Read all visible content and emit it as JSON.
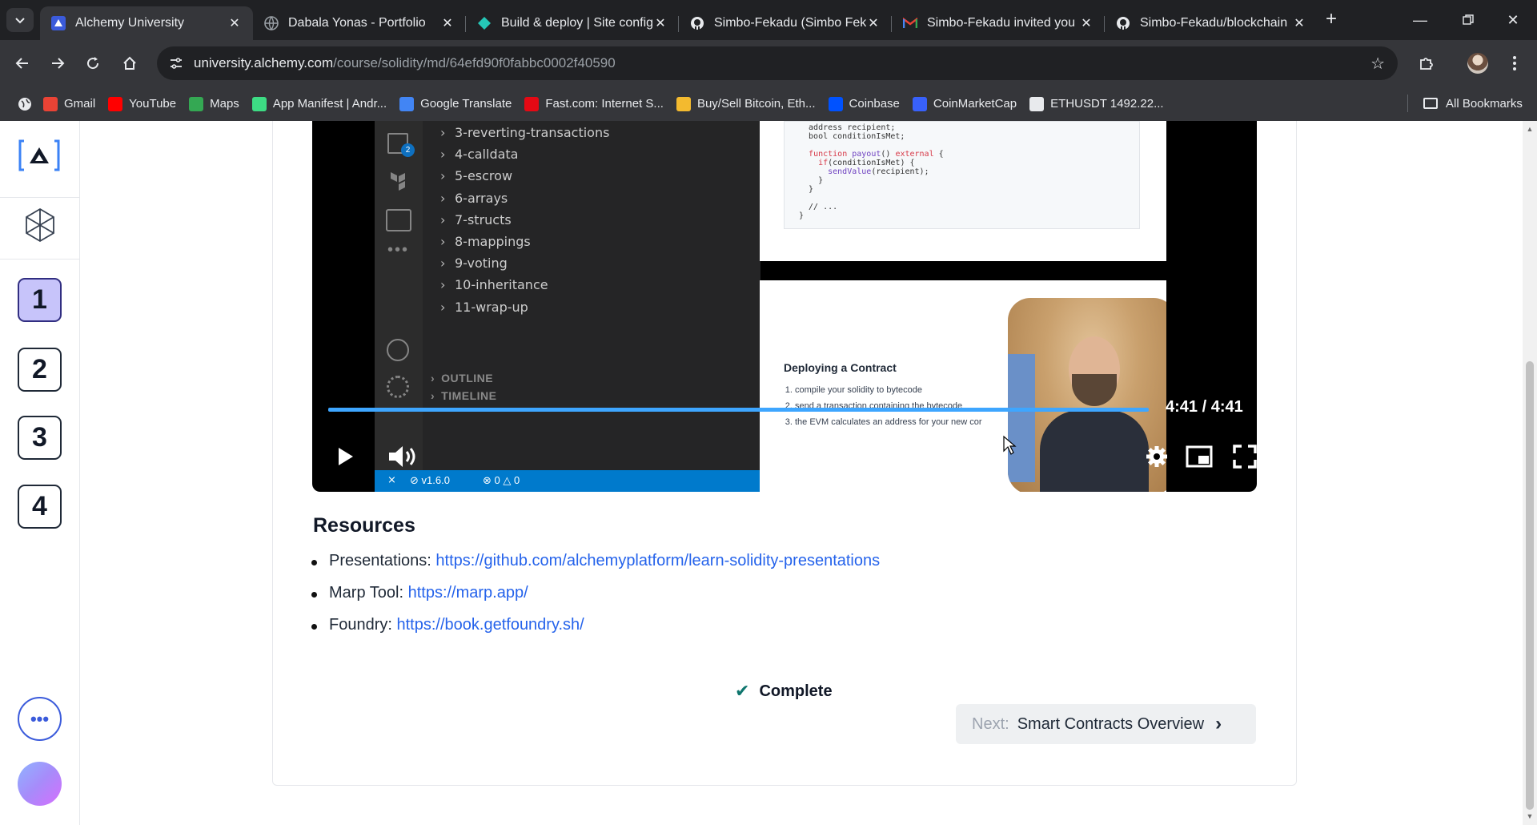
{
  "browser": {
    "tabs": [
      {
        "title": "Alchemy University",
        "icon": "alchemy-icon",
        "active": true
      },
      {
        "title": "Dabala Yonas - Portfolio",
        "icon": "globe-icon",
        "active": false
      },
      {
        "title": "Build & deploy | Site config",
        "icon": "netlify-icon",
        "active": false
      },
      {
        "title": "Simbo-Fekadu (Simbo Feka",
        "icon": "github-icon",
        "active": false
      },
      {
        "title": "Simbo-Fekadu invited you",
        "icon": "gmail-icon",
        "active": false
      },
      {
        "title": "Simbo-Fekadu/blockchain",
        "icon": "github-icon",
        "active": false
      }
    ],
    "url_host": "university.alchemy.com",
    "url_path": "/course/solidity/md/64efd90f0fabbc0002f40590",
    "bookmarks": [
      {
        "label": "Gmail",
        "color": "#ea4335"
      },
      {
        "label": "YouTube",
        "color": "#ff0000"
      },
      {
        "label": "Maps",
        "color": "#34a853"
      },
      {
        "label": "App Manifest | Andr...",
        "color": "#3ddc84"
      },
      {
        "label": "Google Translate",
        "color": "#4285f4"
      },
      {
        "label": "Fast.com: Internet S...",
        "color": "#e50914"
      },
      {
        "label": "Buy/Sell Bitcoin, Eth...",
        "color": "#f3ba2f"
      },
      {
        "label": "Coinbase",
        "color": "#0052ff"
      },
      {
        "label": "CoinMarketCap",
        "color": "#3861fb"
      },
      {
        "label": "ETHUSDT 1492.22...",
        "color": "#e8eaed"
      }
    ],
    "all_bookmarks": "All Bookmarks"
  },
  "sidebar": {
    "steps": [
      "1",
      "2",
      "3",
      "4"
    ],
    "active_step": "1"
  },
  "video": {
    "explorer_items": [
      "3-reverting-transactions",
      "4-calldata",
      "5-escrow",
      "6-arrays",
      "7-structs",
      "8-mappings",
      "9-voting",
      "10-inheritance",
      "11-wrap-up"
    ],
    "outline": "OUTLINE",
    "timeline": "TIMELINE",
    "status": "v1.6.0",
    "status_errors": "0",
    "status_warnings": "0",
    "badge": "2",
    "code_lines": [
      "  address recipient;",
      "  bool conditionIsMet;",
      "",
      "  function payout() external {",
      "    if(conditionIsMet) {",
      "      sendValue(recipient);",
      "    }",
      "  }",
      "",
      "  // ...",
      "}"
    ],
    "slide_title": "Deploying a Contract",
    "slide_steps": [
      "compile your solidity to bytecode",
      "send a transaction containing the bytecode",
      "the EVM calculates an address for your new cor"
    ],
    "time": "4:41 / 4:41",
    "progress_fraction": 1.0
  },
  "resources": {
    "heading": "Resources",
    "items": [
      {
        "label": "Presentations:",
        "link": "https://github.com/alchemyplatform/learn-solidity-presentations"
      },
      {
        "label": "Marp Tool:",
        "link": "https://marp.app/"
      },
      {
        "label": "Foundry:",
        "link": "https://book.getfoundry.sh/"
      }
    ]
  },
  "complete_label": "Complete",
  "next": {
    "prefix": "Next:",
    "label": "Smart Contracts Overview"
  }
}
